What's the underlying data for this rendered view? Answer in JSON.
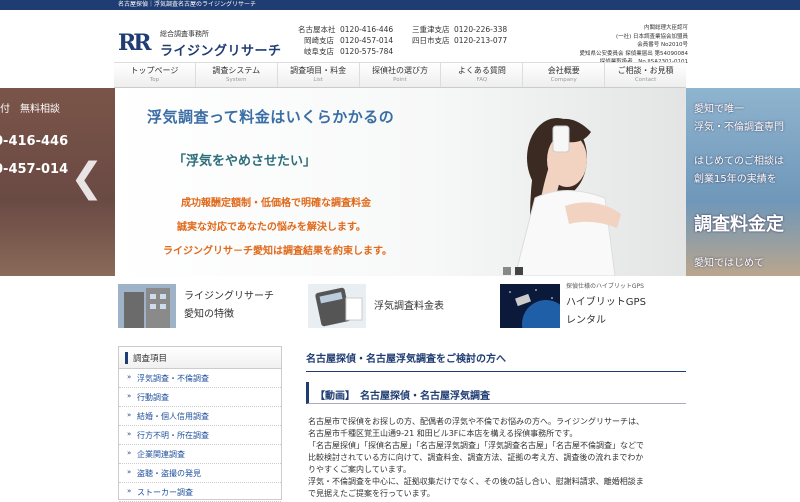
{
  "topbar": {
    "text": "名古屋探偵｜浮気調査名古屋のライジングリサーチ"
  },
  "logo": {
    "mark": "RR",
    "subtitle": "総合調査事務所",
    "name": "ライジングリサーチ"
  },
  "branches": [
    {
      "name": "名古屋本社",
      "tel": "0120-416-446"
    },
    {
      "name": "岡崎支店",
      "tel": "0120-457-014"
    },
    {
      "name": "岐阜支店",
      "tel": "0120-575-784"
    },
    {
      "name": "三重津支店",
      "tel": "0120-226-338"
    },
    {
      "name": "四日市支店",
      "tel": "0120-213-077"
    }
  ],
  "license": [
    "内閣総理大臣認可",
    "(一社) 日本調査業協会加盟員",
    "会員番号 No2010号",
    "愛知県公安委員会 探偵業届出 第54090084",
    "探偵業取扱者　No.JISA2301-0101"
  ],
  "nav": [
    {
      "label": "トップページ",
      "sub": "Top"
    },
    {
      "label": "調査システム",
      "sub": "System"
    },
    {
      "label": "調査項目・料金",
      "sub": "List"
    },
    {
      "label": "探偵社の選び方",
      "sub": "Point"
    },
    {
      "label": "よくある質問",
      "sub": "FAQ"
    },
    {
      "label": "会社概要",
      "sub": "Company"
    },
    {
      "label": "ご相談・お見積",
      "sub": "Contact"
    }
  ],
  "hero": {
    "headline": "浮気調査って料金はいくらかかるの",
    "quote": "「浮気をやめさせたい」",
    "line1": "成功報酬定額制・低価格で明確な調査料金",
    "line2": "誠実な対応であなたの悩みを解決します。",
    "line3": "ライジングリサ－チ愛知は調査結果を約束します。",
    "left_peek": {
      "free": "付　無料相談",
      "tel1": "0-416-446",
      "tel2": "0-457-014"
    },
    "right_peek": [
      "愛知で唯一",
      "浮気・不倫調査専門",
      "はじめてのご相談は",
      "創業15年の実績を",
      "調査料金定",
      "愛知ではじめて"
    ],
    "dots": 2,
    "active_dot": 1
  },
  "features": [
    {
      "line1": "ライジングリサーチ",
      "line2": "愛知の特徴"
    },
    {
      "line1": "浮気調査料金表",
      "line2": ""
    },
    {
      "caption": "探偵仕様のハイブリットGPS",
      "line1": "ハイブリットGPS",
      "line2": "レンタル"
    }
  ],
  "sidebar": {
    "title": "調査項目",
    "items": [
      "浮気調査・不倫調査",
      "行動調査",
      "結婚・個人信用調査",
      "行方不明・所在調査",
      "企業関連調査",
      "盗聴・盗撮の発見",
      "ストーカー調査"
    ]
  },
  "main": {
    "title": "名古屋探偵・名古屋浮気調査をご検討の方へ",
    "movie_heading": "【動画】　名古屋探偵・名古屋浮気調査",
    "paragraphs": [
      "名古屋市で探偵をお探しの方、配偶者の浮気や不倫でお悩みの方へ。ライジングリサーチは、",
      "名古屋市千種区覚王山通9-21 和田ビル3Fに本店を構える探偵事務所です。",
      "「名古屋探偵」「探偵名古屋」「名古屋浮気調査」「浮気調査名古屋」「名古屋不倫調査」などで",
      "比較検討されている方に向けて、調査料金、調査方法、証拠の考え方、調査後の流れまでわか",
      "りやすくご案内しています。",
      "浮気・不倫調査を中心に、証拠収集だけでなく、その後の話し合い、慰謝料請求、離婚相談ま",
      "で見据えたご提案を行っています。"
    ]
  }
}
